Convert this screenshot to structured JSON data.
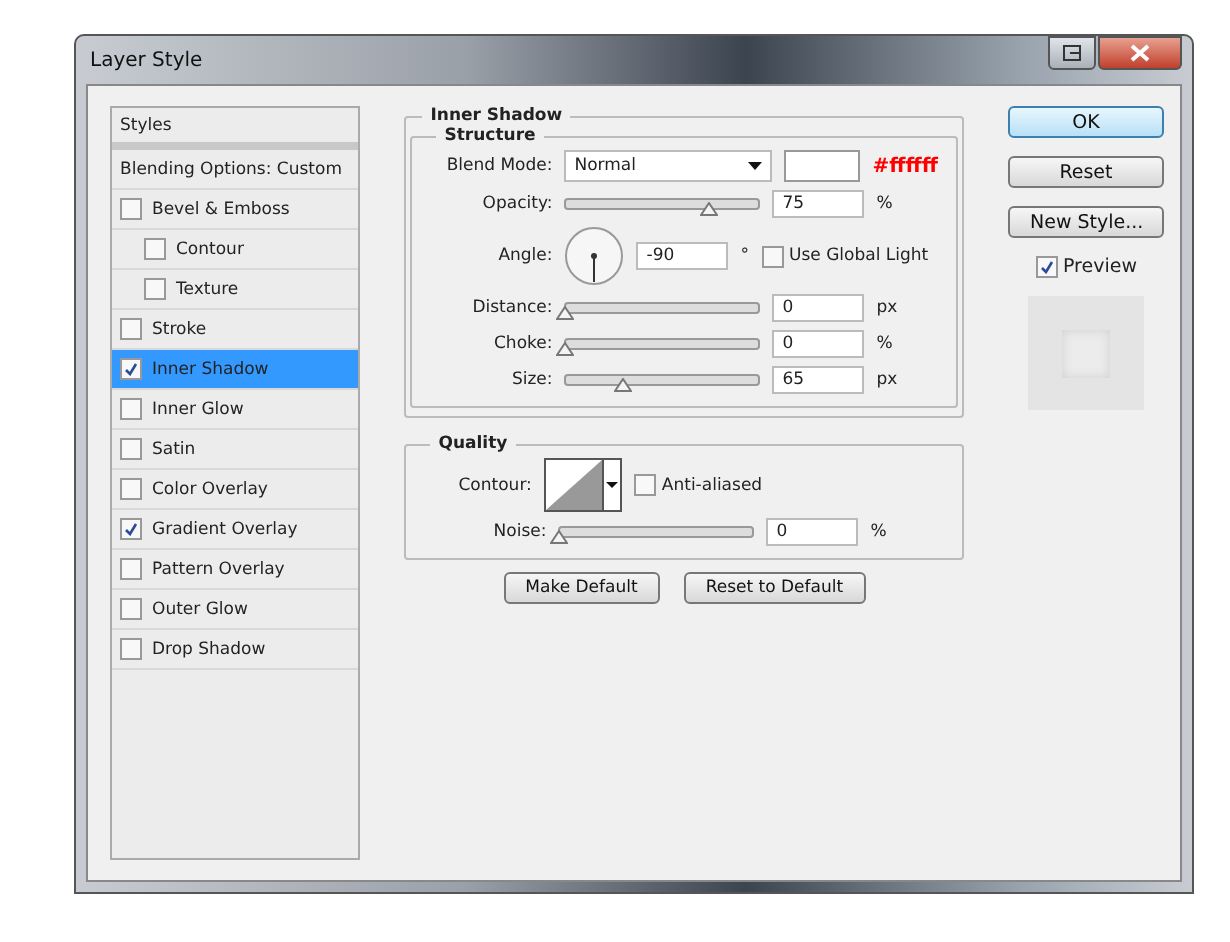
{
  "window": {
    "title": "Layer Style"
  },
  "styles_list": {
    "header": "Styles",
    "blending_options": "Blending Options: Custom",
    "items": [
      {
        "label": "Bevel & Emboss",
        "checked": false,
        "selected": false,
        "children": [
          {
            "label": "Contour",
            "checked": false,
            "selected": false
          },
          {
            "label": "Texture",
            "checked": false,
            "selected": false
          }
        ]
      },
      {
        "label": "Stroke",
        "checked": false,
        "selected": false
      },
      {
        "label": "Inner Shadow",
        "checked": true,
        "selected": true
      },
      {
        "label": "Inner Glow",
        "checked": false,
        "selected": false
      },
      {
        "label": "Satin",
        "checked": false,
        "selected": false
      },
      {
        "label": "Color Overlay",
        "checked": false,
        "selected": false
      },
      {
        "label": "Gradient Overlay",
        "checked": true,
        "selected": false
      },
      {
        "label": "Pattern Overlay",
        "checked": false,
        "selected": false
      },
      {
        "label": "Outer Glow",
        "checked": false,
        "selected": false
      },
      {
        "label": "Drop Shadow",
        "checked": false,
        "selected": false
      }
    ]
  },
  "panel": {
    "title": "Inner Shadow",
    "structure": {
      "title": "Structure",
      "rows": [
        {
          "kind": "blend",
          "label": "Blend Mode:",
          "value": "Normal",
          "color": "#ffffff",
          "color_note": "#ffffff"
        },
        {
          "kind": "slider",
          "label": "Opacity:",
          "level": 0.75,
          "value": "75",
          "unit": "%"
        },
        {
          "kind": "angle",
          "label": "Angle:",
          "value": "-90",
          "unit": "°",
          "checkbox": {
            "label": "Use Global Light",
            "checked": false
          }
        },
        {
          "kind": "slider",
          "label": "Distance:",
          "level": 0,
          "value": "0",
          "unit": "px"
        },
        {
          "kind": "slider",
          "label": "Choke:",
          "level": 0,
          "value": "0",
          "unit": "%"
        },
        {
          "kind": "slider",
          "label": "Size:",
          "level": 0.3,
          "value": "65",
          "unit": "px"
        }
      ]
    },
    "quality": {
      "title": "Quality",
      "contour_label": "Contour:",
      "anti_aliased": {
        "label": "Anti-aliased",
        "checked": false
      },
      "noise": {
        "label": "Noise:",
        "level": 0,
        "value": "0",
        "unit": "%"
      }
    },
    "buttons": [
      "Make Default",
      "Reset to Default"
    ]
  },
  "side": {
    "buttons": [
      {
        "label": "OK",
        "default": true
      },
      {
        "label": "Reset",
        "default": false
      },
      {
        "label": "New Style...",
        "default": false
      }
    ],
    "preview": {
      "label": "Preview",
      "checked": true
    }
  }
}
